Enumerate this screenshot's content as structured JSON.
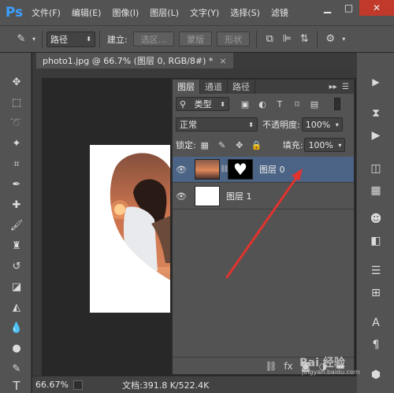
{
  "app": {
    "logo": "Ps"
  },
  "menu": [
    "文件(F)",
    "编辑(E)",
    "图像(I)",
    "图层(L)",
    "文字(Y)",
    "选择(S)",
    "滤镜"
  ],
  "window_controls": {
    "minimize": "▁",
    "restore": "□",
    "close": "✕"
  },
  "options_bar": {
    "mode_select": "路径",
    "build_label": "建立:",
    "selection_button": "选区...",
    "mask_button": "蒙版",
    "shape_button": "形状"
  },
  "document": {
    "tab_title": "photo1.jpg @ 66.7% (图层 0, RGB/8#) *",
    "close": "×"
  },
  "layers_panel": {
    "tabs": [
      "图层",
      "通道",
      "路径"
    ],
    "filter_kind": "类型",
    "blend_mode": "正常",
    "opacity_label": "不透明度:",
    "opacity_value": "100%",
    "lock_label": "锁定:",
    "fill_label": "填充:",
    "fill_value": "100%",
    "layers": [
      {
        "name": "图层 0",
        "selected": true,
        "has_mask": true
      },
      {
        "name": "图层 1",
        "selected": false,
        "has_mask": false
      }
    ]
  },
  "status_bar": {
    "zoom": "66.67%",
    "doc_info": "文档:391.8 K/522.4K"
  },
  "watermark": {
    "brand": "Bai 经验",
    "url": "jingyan.baidu.com"
  },
  "colors": {
    "accent_selection": "#4b6384",
    "arrow": "#e0332e",
    "ps_blue": "#3aa0ff"
  }
}
